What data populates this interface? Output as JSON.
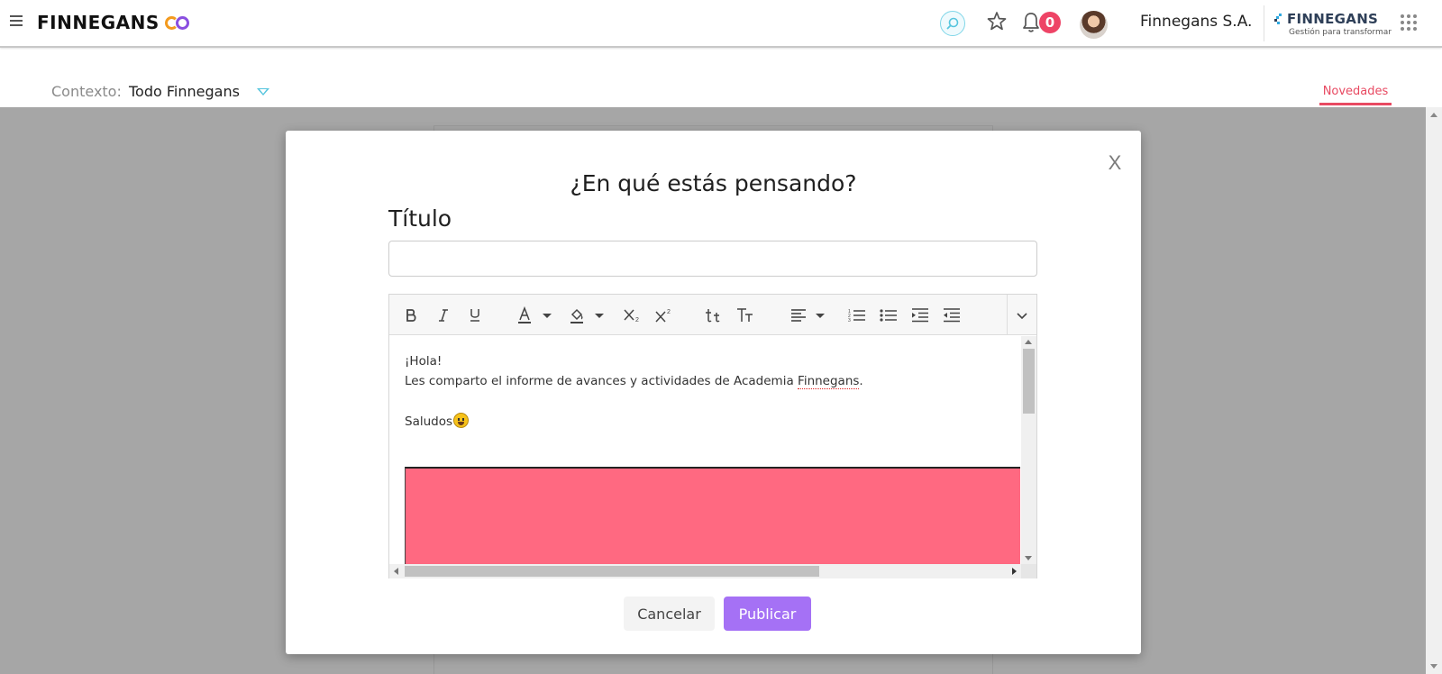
{
  "header": {
    "brand": "FINNEGANS",
    "notifications_count": "0",
    "company_name": "Finnegans S.A.",
    "logo_text": "FINNEGANS",
    "logo_tagline": "Gestión para transformar",
    "icons": [
      "menu-icon",
      "search-icon",
      "star-icon",
      "bell-icon",
      "avatar",
      "apps-grid-icon"
    ]
  },
  "context": {
    "label": "Contexto:",
    "value": "Todo Finnegans",
    "tab_label": "Novedades"
  },
  "modal": {
    "close_label": "X",
    "title": "¿En qué estás pensando?",
    "field_label": "Título",
    "title_value": "",
    "toolbar_icons": [
      "bold-icon",
      "italic-icon",
      "underline-icon",
      "font-color-icon",
      "highlight-color-icon",
      "subscript-icon",
      "superscript-icon",
      "small-caps-icon",
      "uppercase-icon",
      "align-icon",
      "ordered-list-icon",
      "unordered-list-icon",
      "indent-icon",
      "outdent-icon",
      "more-chevron-icon"
    ],
    "editor": {
      "greeting": "¡Hola!",
      "body_before": "Les comparto el informe de avances y actividades de Academia ",
      "body_word": "Finnegans",
      "body_after": ".",
      "closing": "Saludos"
    },
    "cancel_label": "Cancelar",
    "publish_label": "Publicar"
  },
  "colors": {
    "accent_purple": "#a571f5",
    "accent_red": "#e84a62",
    "badge": "#ee4466",
    "embedded_block": "#ff6981",
    "search_ring": "#7fd6e8"
  }
}
